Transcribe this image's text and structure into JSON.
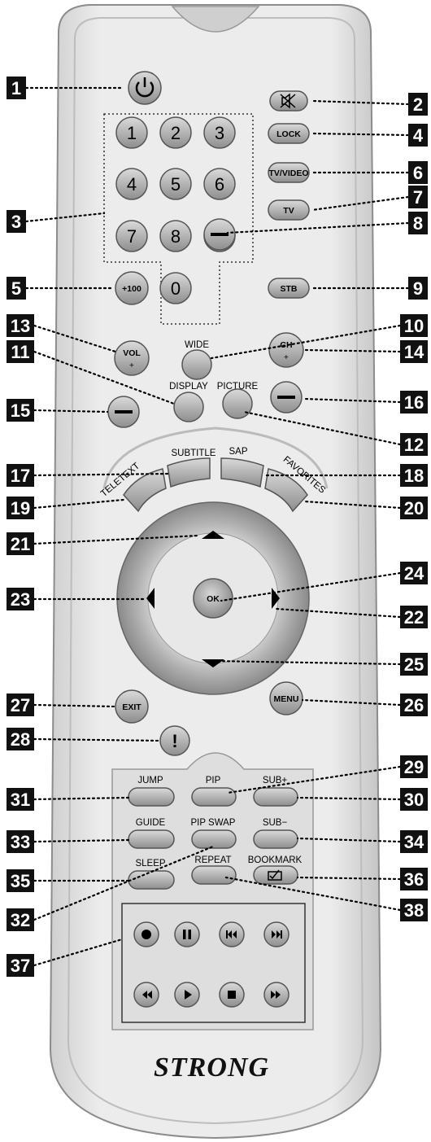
{
  "brand": "STRONG",
  "labels": {
    "wide": "WIDE",
    "display": "DISPLAY",
    "picture": "PICTURE",
    "subtitle": "SUBTITLE",
    "sap": "SAP",
    "teletext": "TELETEXT",
    "favorites": "FAVORITES",
    "jump": "JUMP",
    "pip": "PIP",
    "sub_plus": "SUB+",
    "guide": "GUIDE",
    "pip_swap": "PIP SWAP",
    "sub_minus": "SUB−",
    "sleep": "SLEEP",
    "repeat": "REPEAT",
    "bookmark": "BOOKMARK"
  },
  "buttons": {
    "lock": "LOCK",
    "tv_video": "TV/VIDEO",
    "tv": "TV",
    "stb": "STB",
    "plus100": "+100",
    "vol": "VOL",
    "ch": "CH",
    "plus": "+",
    "minus": "−",
    "ok": "OK",
    "exit": "EXIT",
    "menu": "MENU",
    "info": "!",
    "digits": [
      "1",
      "2",
      "3",
      "4",
      "5",
      "6",
      "7",
      "8",
      "9",
      "0"
    ]
  },
  "callouts": [
    "1",
    "2",
    "3",
    "4",
    "5",
    "6",
    "7",
    "8",
    "9",
    "10",
    "11",
    "12",
    "13",
    "14",
    "15",
    "16",
    "17",
    "18",
    "19",
    "20",
    "21",
    "22",
    "23",
    "24",
    "25",
    "26",
    "27",
    "28",
    "29",
    "30",
    "31",
    "32",
    "33",
    "34",
    "35",
    "36",
    "37",
    "38"
  ],
  "colors": {
    "body": "#e2e2e2",
    "body_edge": "#8c8c8c",
    "button": "#b8b8b8",
    "button_dark": "#7a7a7a",
    "callout_bg": "#111111"
  }
}
